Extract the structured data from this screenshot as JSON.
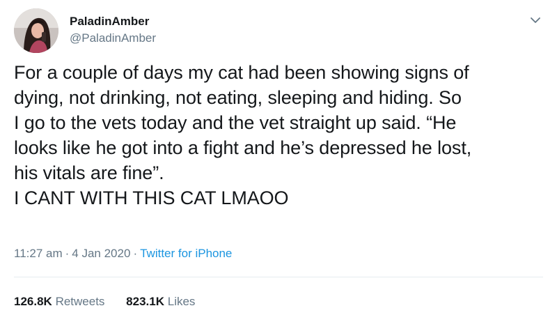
{
  "author": {
    "display_name": "PaladinAmber",
    "handle": "@PaladinAmber"
  },
  "tweet": {
    "lines": [
      "For a couple of days my cat had been showing signs of",
      "dying, not drinking, not eating, sleeping and hiding. So",
      "I go to the vets today and the vet straight up said. “He",
      "looks like he got into a fight and he’s depressed he lost,",
      "his vitals are fine”.",
      "I CANT WITH THIS CAT LMAOO"
    ]
  },
  "meta": {
    "time": "11:27 am",
    "separator": "·",
    "date": "4 Jan 2020",
    "source": "Twitter for iPhone"
  },
  "stats": {
    "retweets_count": "126.8K",
    "retweets_label": "Retweets",
    "likes_count": "823.1K",
    "likes_label": "Likes"
  },
  "colors": {
    "text": "#14171a",
    "secondary": "#657786",
    "link": "#1b95e0",
    "divider": "#e6ecf0"
  },
  "icons": {
    "caret": "chevron-down-icon",
    "avatar": "avatar"
  }
}
